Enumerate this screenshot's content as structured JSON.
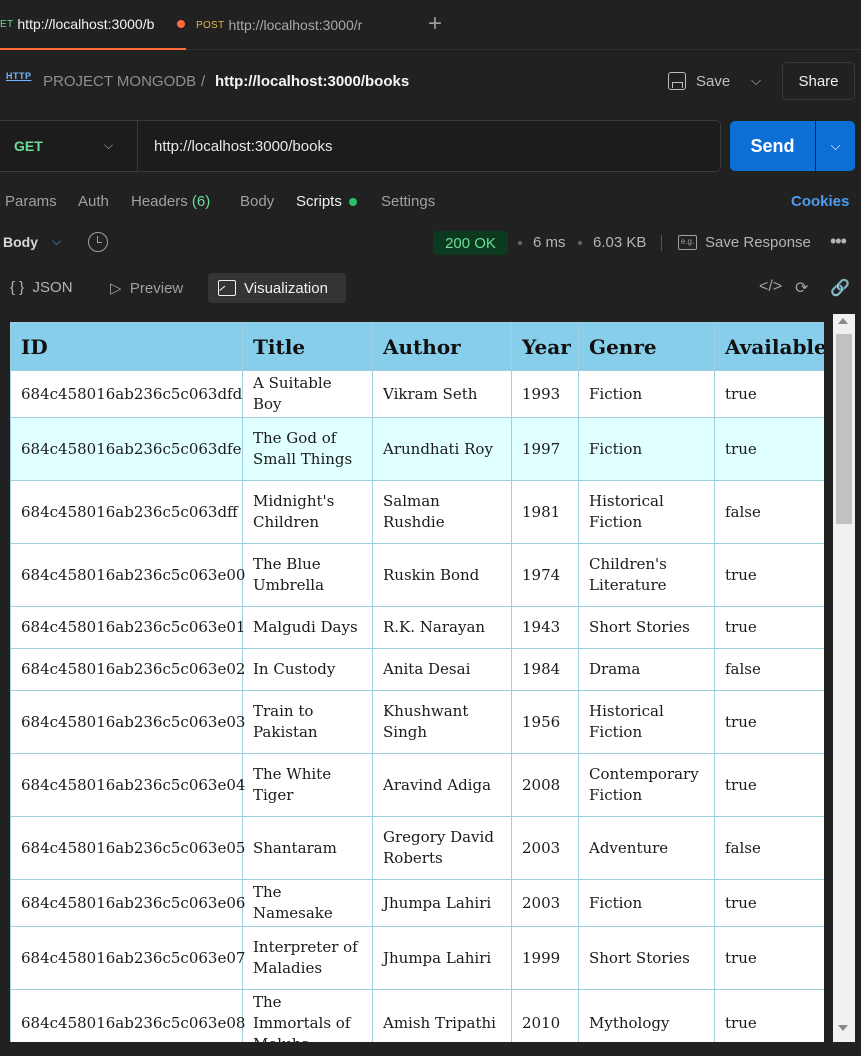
{
  "tabs": [
    {
      "method": "ET",
      "url": "http://localhost:3000/b",
      "unsaved": true
    },
    {
      "method": "POST",
      "url": "http://localhost:3000/r",
      "unsaved": false
    }
  ],
  "header": {
    "icon_label": "HTTP",
    "project": "PROJECT MONGODB",
    "separator": "/",
    "current": "http://localhost:3000/books",
    "save_label": "Save",
    "share_label": "Share"
  },
  "request": {
    "method": "GET",
    "url": "http://localhost:3000/books",
    "send_label": "Send"
  },
  "request_tabs": {
    "params": "Params",
    "auth": "Auth",
    "headers": "Headers",
    "headers_count": "(6)",
    "body": "Body",
    "scripts": "Scripts",
    "settings": "Settings",
    "cookies": "Cookies"
  },
  "response": {
    "body_label": "Body",
    "status": "200 OK",
    "time": "6 ms",
    "size": "6.03 KB",
    "eg_label": "e.g.",
    "save_response": "Save Response"
  },
  "view_modes": {
    "json": "JSON",
    "preview": "Preview",
    "visualization": "Visualization"
  },
  "table": {
    "headers": [
      "ID",
      "Title",
      "Author",
      "Year",
      "Genre",
      "Available"
    ],
    "rows": [
      [
        "684c458016ab236c5c063dfd",
        "A Suitable Boy",
        "Vikram Seth",
        "1993",
        "Fiction",
        "true"
      ],
      [
        "684c458016ab236c5c063dfe",
        "The God of Small Things",
        "Arundhati Roy",
        "1997",
        "Fiction",
        "true"
      ],
      [
        "684c458016ab236c5c063dff",
        "Midnight's Children",
        "Salman Rushdie",
        "1981",
        "Historical Fiction",
        "false"
      ],
      [
        "684c458016ab236c5c063e00",
        "The Blue Umbrella",
        "Ruskin Bond",
        "1974",
        "Children's Literature",
        "true"
      ],
      [
        "684c458016ab236c5c063e01",
        "Malgudi Days",
        "R.K. Narayan",
        "1943",
        "Short Stories",
        "true"
      ],
      [
        "684c458016ab236c5c063e02",
        "In Custody",
        "Anita Desai",
        "1984",
        "Drama",
        "false"
      ],
      [
        "684c458016ab236c5c063e03",
        "Train to Pakistan",
        "Khushwant Singh",
        "1956",
        "Historical Fiction",
        "true"
      ],
      [
        "684c458016ab236c5c063e04",
        "The White Tiger",
        "Aravind Adiga",
        "2008",
        "Contemporary Fiction",
        "true"
      ],
      [
        "684c458016ab236c5c063e05",
        "Shantaram",
        "Gregory David Roberts",
        "2003",
        "Adventure",
        "false"
      ],
      [
        "684c458016ab236c5c063e06",
        "The Namesake",
        "Jhumpa Lahiri",
        "2003",
        "Fiction",
        "true"
      ],
      [
        "684c458016ab236c5c063e07",
        "Interpreter of Maladies",
        "Jhumpa Lahiri",
        "1999",
        "Short Stories",
        "true"
      ],
      [
        "684c458016ab236c5c063e08",
        "The Immortals of Meluha",
        "Amish Tripathi",
        "2010",
        "Mythology",
        "true"
      ]
    ]
  },
  "colors": {
    "accent": "#ff6c37",
    "send": "#0c6fd6",
    "table_header": "#87ceeb",
    "row_alt": "#e0ffff",
    "status_ok": "#6bdd9a"
  }
}
